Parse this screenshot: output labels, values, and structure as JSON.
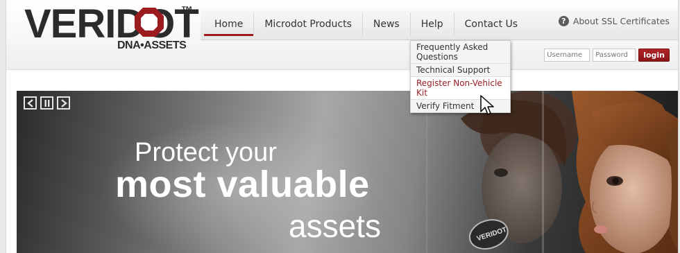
{
  "brand": {
    "name": "VERIDOT",
    "trademark": "™",
    "tagline": "DNA•ASSETS",
    "primary_color": "#9b1b1e"
  },
  "nav": {
    "items": [
      {
        "label": "Home",
        "active": true
      },
      {
        "label": "Microdot Products",
        "active": false
      },
      {
        "label": "News",
        "active": false
      },
      {
        "label": "Help",
        "active": false
      },
      {
        "label": "Contact Us",
        "active": false
      }
    ]
  },
  "ssl": {
    "label": "About SSL Certificates",
    "icon": "question-circle-icon"
  },
  "login": {
    "username_placeholder": "Username",
    "password_placeholder": "Password",
    "button_label": "login"
  },
  "help_menu": {
    "items": [
      {
        "label": "Frequently Asked Questions"
      },
      {
        "label": "Technical Support"
      },
      {
        "label": "Register Non-Vehicle Kit"
      },
      {
        "label": "Verify Fitment"
      }
    ]
  },
  "slideshow": {
    "controls": [
      "prev-icon",
      "pause-icon",
      "next-icon"
    ],
    "headline_1": "Protect your",
    "headline_2": "most valuable",
    "headline_3": "assets",
    "decal_text": "VERIDOT"
  }
}
